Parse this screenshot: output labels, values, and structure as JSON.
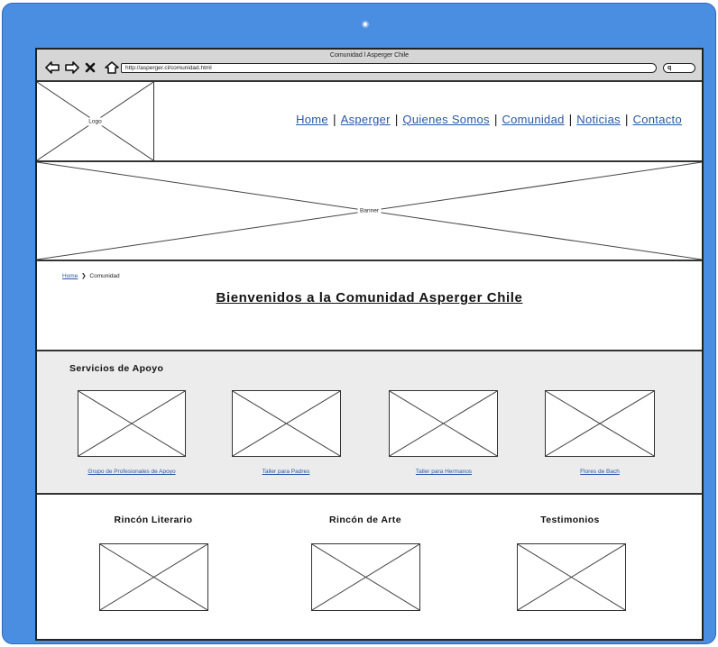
{
  "browser": {
    "window_title": "Comunidad l Asperger Chile",
    "url": "http://asperger.cl/comunidad.html",
    "nav_icons": [
      "back-arrow-icon",
      "forward-arrow-icon",
      "close-icon",
      "home-icon"
    ],
    "search_icon": "search-icon"
  },
  "header": {
    "logo_label": "Logo",
    "nav": [
      "Home",
      "Asperger",
      "Quienes Somos",
      "Comunidad",
      "Noticias",
      "Contacto"
    ],
    "separator": "|"
  },
  "banner": {
    "label": "Banner"
  },
  "breadcrumb": {
    "home": "Home",
    "chevron": "❯",
    "current": "Comunidad"
  },
  "page": {
    "title": "Bienvenidos a la Comunidad Asperger Chile"
  },
  "servicios": {
    "title": "Servicios de Apoyo",
    "items": [
      {
        "label": "Grupo de Profesionales de Apoyo"
      },
      {
        "label": "Taller para Padres"
      },
      {
        "label": "Taller para Hermanos"
      },
      {
        "label": "Flores de Bach"
      }
    ]
  },
  "bottom": {
    "columns": [
      {
        "title": "Rincón Literario"
      },
      {
        "title": "Rincón de Arte"
      },
      {
        "title": "Testimonios"
      }
    ]
  },
  "colors": {
    "device_frame": "#4a8ee2",
    "link": "#2857a4",
    "section_bg": "#ececec",
    "chrome_bg": "#d6d6d6"
  }
}
